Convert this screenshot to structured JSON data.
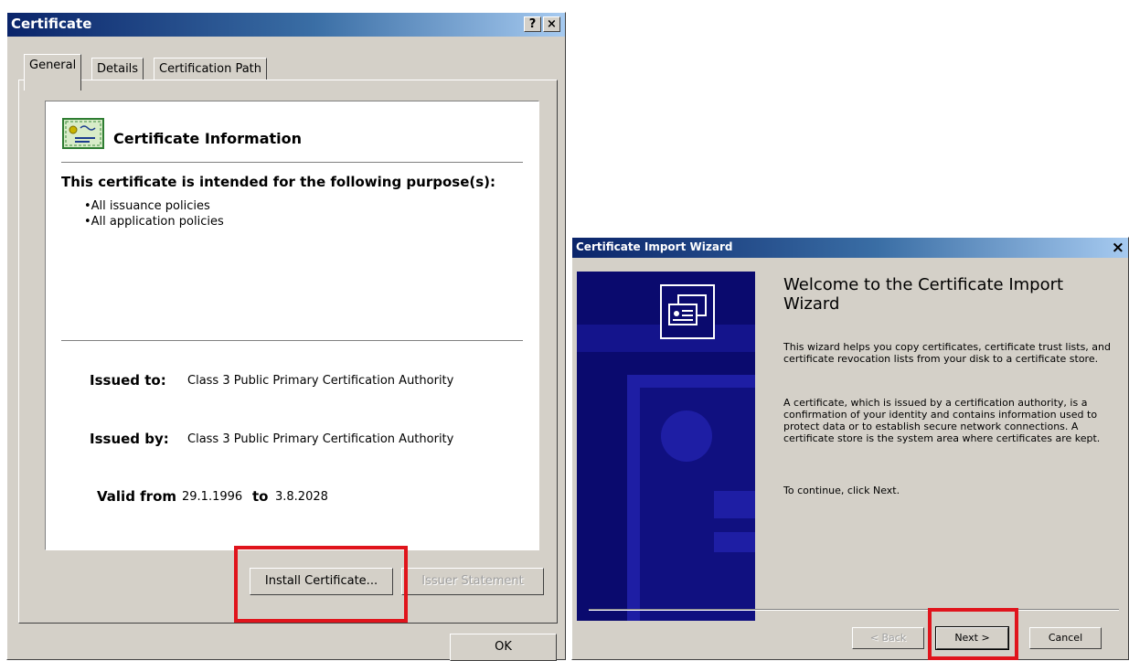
{
  "certificate_dialog": {
    "title": "Certificate",
    "help_button": "?",
    "close_button": "×",
    "tabs": [
      "General",
      "Details",
      "Certification Path"
    ],
    "info_heading": "Certificate Information",
    "purpose_heading": "This certificate is intended for the following purpose(s):",
    "purposes": [
      "•All issuance policies",
      "•All application policies"
    ],
    "issued_to_label": "Issued to:",
    "issued_to_value": "Class 3 Public Primary Certification Authority",
    "issued_by_label": "Issued by:",
    "issued_by_value": "Class 3 Public Primary Certification Authority",
    "valid_from_label": "Valid from",
    "valid_from_value": "29.1.1996",
    "valid_to_label": "to",
    "valid_to_value": "3.8.2028",
    "install_button": "Install Certificate...",
    "issuer_statement_button": "Issuer Statement",
    "ok_button": "OK"
  },
  "wizard_dialog": {
    "title": "Certificate Import Wizard",
    "close_button": "×",
    "heading": "Welcome to the Certificate Import Wizard",
    "paragraph1": "This wizard helps you copy certificates, certificate trust lists, and certificate revocation lists from your disk to a certificate store.",
    "paragraph2": "A certificate, which is issued by a certification authority, is a confirmation of your identity and contains information used to protect data or to establish secure network connections. A certificate store is the system area where certificates are kept.",
    "paragraph3": "To continue, click Next.",
    "back_button": "< Back",
    "next_button": "Next >",
    "cancel_button": "Cancel"
  },
  "colors": {
    "highlight_box": "#e0141c",
    "titlebar": "#0a246a",
    "dialog_face": "#d4d0c8",
    "wizard_banner": "#0a0a6e"
  }
}
